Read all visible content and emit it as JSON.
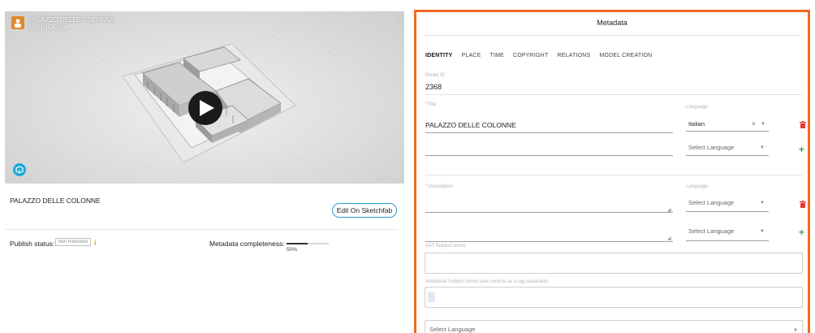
{
  "viewer": {
    "model_title": "PALAZZO DELLE COLONNE",
    "byline": "by UniGiudge...",
    "more_icon": "more-icon",
    "play_icon": "play-icon",
    "sketchfab_icon": "sketchfab-logo-icon"
  },
  "model": {
    "name": "PALAZZO DELLE COLONNE",
    "edit_button": "Edit On Sketchfab"
  },
  "status": {
    "publish_label": "Publish status:",
    "publish_value": "Non Published",
    "metadata_label": "Metadata completeness:",
    "completeness_percent": 50,
    "completeness_text": "50%"
  },
  "metadata": {
    "title": "Metadata",
    "tabs": [
      {
        "label": "IDENTITY",
        "active": true
      },
      {
        "label": "PLACE",
        "active": false
      },
      {
        "label": "TIME",
        "active": false
      },
      {
        "label": "COPYRIGHT",
        "active": false
      },
      {
        "label": "RELATIONS",
        "active": false
      },
      {
        "label": "MODEL CREATION",
        "active": false
      }
    ],
    "model_id_label": "Model ID",
    "model_id": "2368",
    "title_label": "*Title",
    "title_value": "PALAZZO DELLE COLONNE",
    "language_label": "Language",
    "language_selected": "Italian",
    "language_placeholder": "Select Language",
    "description_label": "* Description",
    "description_language_label": "Language",
    "aat_label": "AAT Subject terms",
    "additional_label": "Additional Subject terms (use comma as a tag separator)",
    "bottom_select": "Select Language"
  },
  "colors": {
    "accent_border": "#ec6b1f",
    "delete": "#e53935",
    "add": "#43a047",
    "edit_border": "#2d9bd5"
  }
}
